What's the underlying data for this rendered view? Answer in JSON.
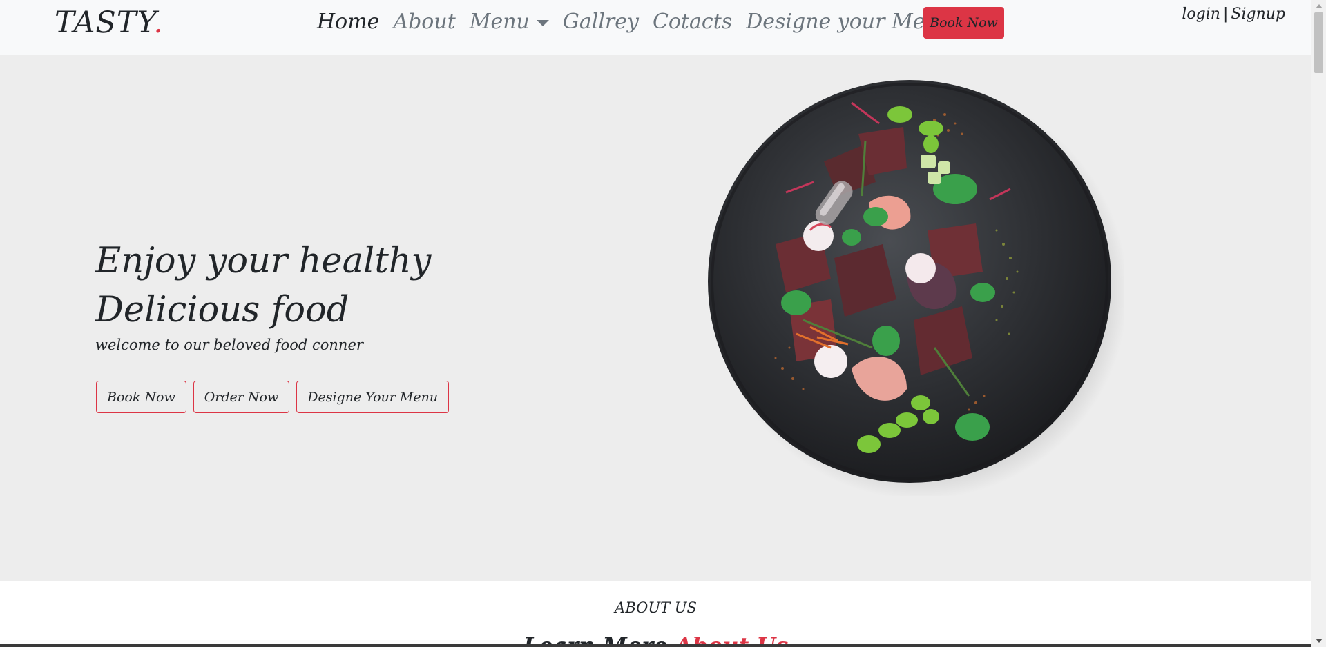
{
  "navbar": {
    "brand": "TASTY",
    "brand_dot": ".",
    "links": {
      "home": "Home",
      "about": "About",
      "menu": "Menu",
      "gallery": "Gallrey",
      "contacts": "Cotacts",
      "design_menu": "Designe your Menu"
    },
    "book_button": "Book Now",
    "auth": {
      "login": "login",
      "separator": "|",
      "signup": "Signup"
    }
  },
  "hero": {
    "title_line1": "Enjoy your healthy",
    "title_line2": "Delicious food",
    "subtitle": "welcome to our beloved food conner",
    "buttons": {
      "book": "Book Now",
      "order": "Order Now",
      "design": "Designe Your Menu"
    }
  },
  "about": {
    "label": "ABOUT US",
    "heading_prefix": "Learn More",
    "heading_accent": "About Us"
  },
  "colors": {
    "accent": "#dc3545",
    "navbar_bg": "#f8f9fa",
    "hero_bg": "#ededed",
    "text": "#212529",
    "muted": "#6c757d"
  },
  "icons": {
    "menu_dropdown": "chevron-down-icon",
    "hero_image": "food-plate-image"
  }
}
